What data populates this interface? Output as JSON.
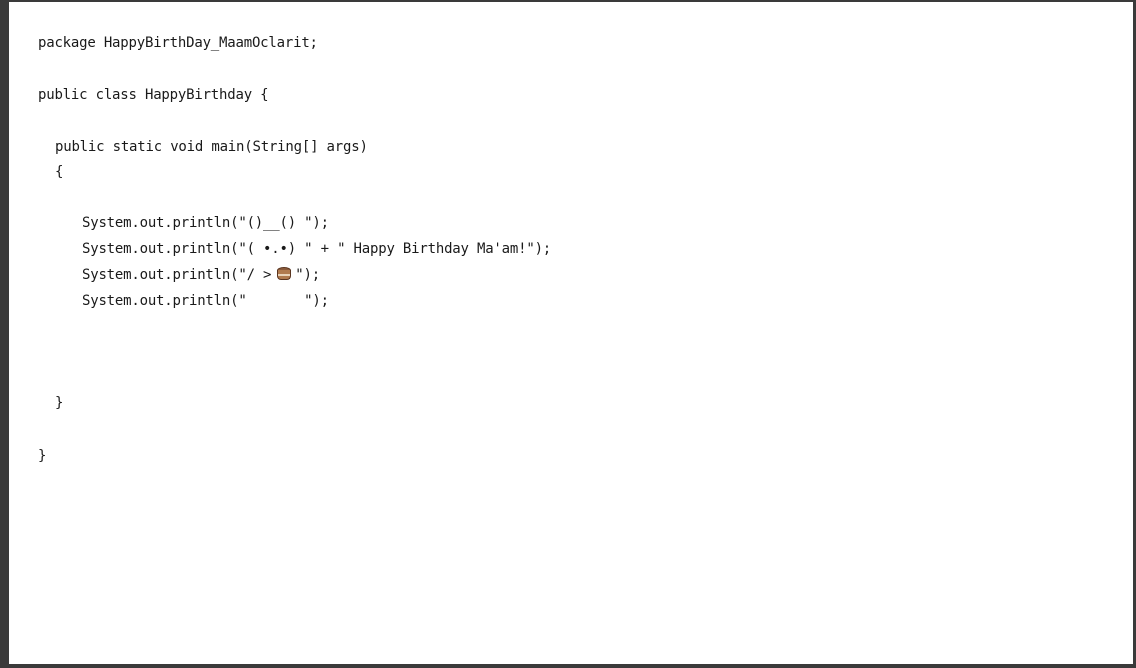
{
  "editor": {
    "lines": {
      "package_line": "package HappyBirthDay_MaamOclarit;",
      "class_line": "public class HappyBirthday {",
      "main_line": "public static void main(String[] args)",
      "main_open": "{",
      "print1": "System.out.println(\"()__() \");",
      "print2": "System.out.println(\"( •.•) \" + \" Happy Birthday Ma'am!\");",
      "print3_before": "System.out.println(\"/ >",
      "print3_after": "\");",
      "print4": "System.out.println(\"       \");",
      "main_close": "}",
      "class_close": "}"
    },
    "icons": {
      "cake": "birthday-cake-icon"
    }
  }
}
